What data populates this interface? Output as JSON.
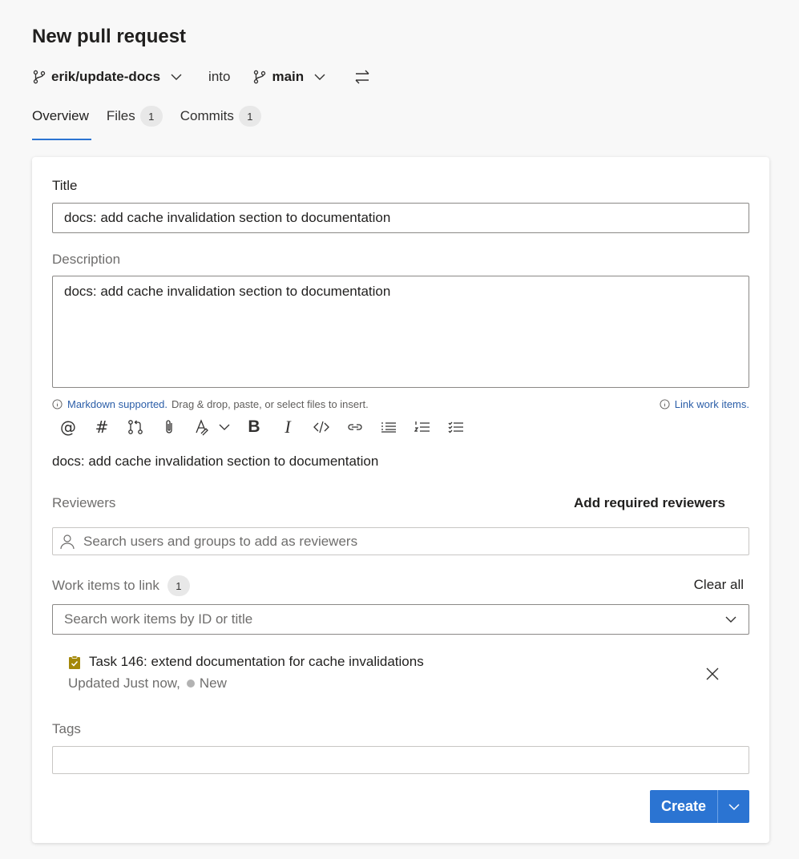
{
  "page": {
    "title": "New pull request"
  },
  "branches": {
    "source": "erik/update-docs",
    "into": "into",
    "target": "main"
  },
  "tabs": [
    {
      "label": "Overview",
      "count": null,
      "active": true
    },
    {
      "label": "Files",
      "count": "1"
    },
    {
      "label": "Commits",
      "count": "1"
    }
  ],
  "form": {
    "title_label": "Title",
    "title_value": "docs: add cache invalidation section to documentation",
    "description_label": "Description",
    "description_value": "docs: add cache invalidation section to documentation",
    "markdown_link": "Markdown supported.",
    "markdown_hint": "Drag & drop, paste, or select files to insert.",
    "link_work_items": "Link work items.",
    "toolbar": {
      "mention": "@",
      "hashtag": "#",
      "bold": "B",
      "italic": "I"
    },
    "preview_text": "docs: add cache invalidation section to documentation",
    "reviewers_label": "Reviewers",
    "add_required_reviewers": "Add required reviewers",
    "reviewers_placeholder": "Search users and groups to add as reviewers",
    "work_items_label": "Work items to link",
    "work_items_count": "1",
    "clear_all": "Clear all",
    "work_items_placeholder": "Search work items by ID or title",
    "work_item": {
      "title": "Task 146: extend documentation for cache invalidations",
      "updated": "Updated Just now,",
      "state": "New"
    },
    "tags_label": "Tags",
    "create_button": "Create"
  },
  "colors": {
    "accent": "#2b74d2",
    "task_icon": "#a4880a",
    "link": "#2b5ea8"
  }
}
